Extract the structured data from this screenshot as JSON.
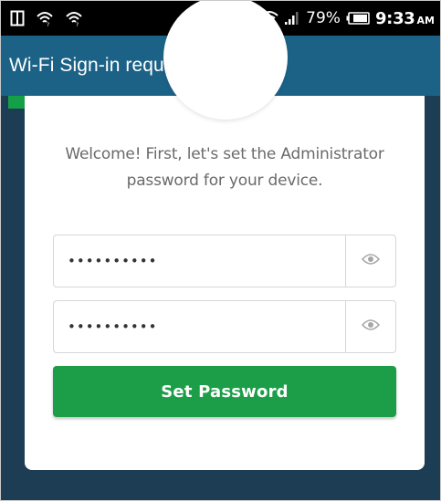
{
  "status_bar": {
    "battery_percent": "79%",
    "time": "9:33",
    "ampm": "AM"
  },
  "app_bar": {
    "title": "Wi-Fi Sign-in required"
  },
  "card": {
    "welcome_line1": "Welcome! First, let's set the Administrator",
    "welcome_line2": "password for your device.",
    "password_value": "••••••••••",
    "confirm_value": "••••••••••",
    "button_label": "Set Password"
  },
  "colors": {
    "status_bar_bg": "#000000",
    "app_bar_bg": "#1c6287",
    "content_bg": "#1d3d54",
    "button_bg": "#1c9e48",
    "accent": "#14a046"
  },
  "icons": [
    "screen-mirror-icon",
    "wifi-icon",
    "wifi-icon",
    "bluetooth-icon",
    "alarm-icon",
    "wifi-signal-icon",
    "cell-signal-icon",
    "battery-icon",
    "eye-icon"
  ]
}
